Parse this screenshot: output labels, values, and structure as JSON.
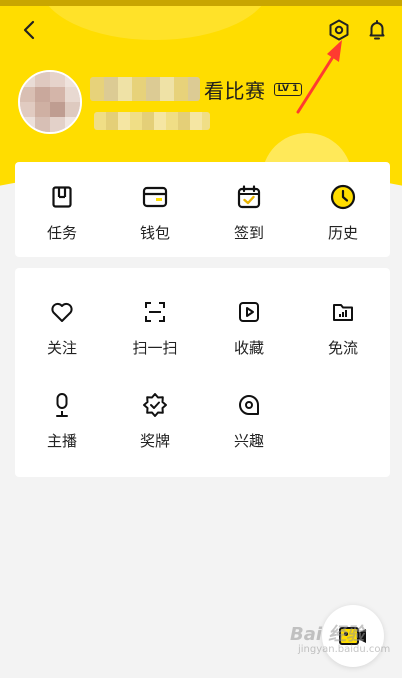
{
  "profile": {
    "name_visible_part": "看比赛",
    "level": "LV 1"
  },
  "quick_actions": [
    {
      "label": "任务",
      "icon": "task-icon"
    },
    {
      "label": "钱包",
      "icon": "wallet-icon"
    },
    {
      "label": "签到",
      "icon": "checkin-calendar-icon"
    },
    {
      "label": "历史",
      "icon": "history-clock-icon"
    }
  ],
  "tools": [
    {
      "label": "关注",
      "icon": "heart-icon"
    },
    {
      "label": "扫一扫",
      "icon": "scan-icon"
    },
    {
      "label": "收藏",
      "icon": "play-square-icon"
    },
    {
      "label": "免流",
      "icon": "data-folder-icon"
    },
    {
      "label": "主播",
      "icon": "microphone-icon"
    },
    {
      "label": "奖牌",
      "icon": "medal-icon"
    },
    {
      "label": "兴趣",
      "icon": "interest-bubble-icon"
    }
  ],
  "watermark": {
    "title": "Bai 经验",
    "subtitle": "jingyan.baidu.com"
  },
  "colors": {
    "header_yellow": "#ffdd00",
    "annotation_red": "#ff3b30",
    "page_background": "#f3f3f3"
  }
}
